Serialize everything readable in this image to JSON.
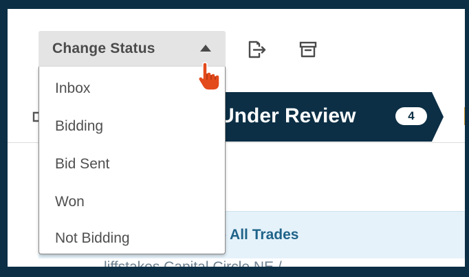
{
  "toolbar": {
    "change_status_label": "Change Status",
    "caret_icon": "caret-up-icon",
    "export_icon": "export-icon",
    "archive_icon": "archive-icon"
  },
  "status_menu": {
    "options": [
      "Inbox",
      "Bidding",
      "Bid Sent",
      "Won",
      "Not Bidding"
    ]
  },
  "stage_bar": {
    "current_stage": "Under Review",
    "current_count": "4"
  },
  "table": {
    "group_title": "r - All Trades",
    "partial_row_text": "liffstakes Capital Circle NE /"
  },
  "colors": {
    "frame": "#0c2f45",
    "stage_active": "#0c2f45",
    "group_row_bg": "#e5f2fa",
    "group_title": "#1f6389",
    "cursor": "#e34a1c"
  }
}
